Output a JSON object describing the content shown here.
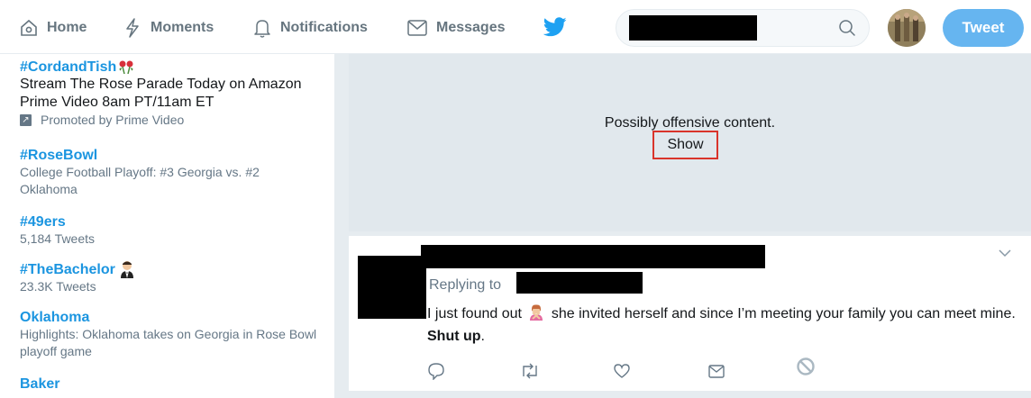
{
  "nav": {
    "home": "Home",
    "moments": "Moments",
    "notifications": "Notifications",
    "messages": "Messages",
    "tweet_button": "Tweet"
  },
  "trends": [
    {
      "name": "#CordandTish",
      "emoji": "rose",
      "desc": "Stream The Rose Parade Today on Amazon Prime Video 8am PT/11am ET",
      "meta": "Promoted by Prime Video"
    },
    {
      "name": "#RoseBowl",
      "meta": "College Football Playoff: #3 Georgia vs. #2 Oklahoma"
    },
    {
      "name": "#49ers",
      "meta": "5,184 Tweets"
    },
    {
      "name": "#TheBachelor",
      "emoji": "man-in-tuxedo",
      "meta": "23.3K Tweets"
    },
    {
      "name": "Oklahoma",
      "meta": "Highlights: Oklahoma takes on Georgia in Rose Bowl playoff game"
    },
    {
      "name": "Baker"
    }
  ],
  "media": {
    "warning": "Possibly offensive content.",
    "show_label": "Show",
    "highlight_color": "#d9342b"
  },
  "tweet": {
    "replying_to": "Replying to",
    "text_before_emoji": "I just found out",
    "emoji": "person-gesturing-no",
    "text_after_emoji": "she invited herself and since I’m meeting your family you can meet mine.",
    "text_bold": "Shut up",
    "text_end": "."
  },
  "colors": {
    "brand": "#1da1f2",
    "tweet_button": "#66b5f0",
    "link": "#1b95e0",
    "muted": "#657786"
  }
}
